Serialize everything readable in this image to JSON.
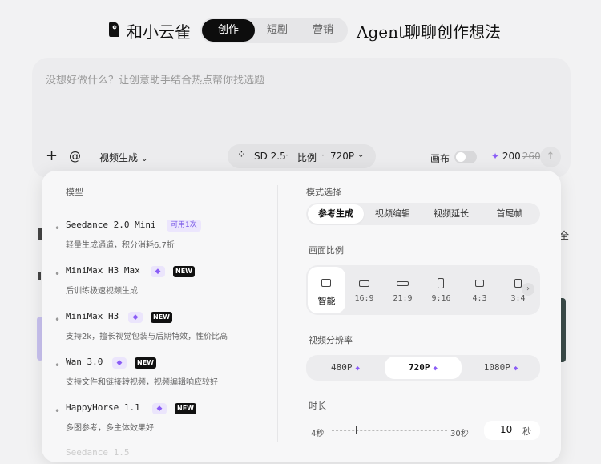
{
  "header": {
    "brand": "和小云雀",
    "tabs": [
      {
        "label": "创作",
        "active": true
      },
      {
        "label": "短剧",
        "active": false
      },
      {
        "label": "营销",
        "active": false
      }
    ],
    "agent_text": "Agent聊聊创作想法"
  },
  "input": {
    "placeholder": "没想好做什么？让创意助手结合热点帮你找选题"
  },
  "toolbar": {
    "plus": "+",
    "at": "@",
    "mode_label": "视频生成",
    "model_name": "SD 2.5",
    "ratio_label": "比例",
    "resolution": "720P",
    "canvas_label": "画布",
    "credits": "200",
    "credits_old": "260"
  },
  "panel": {
    "models_title": "模型",
    "models": [
      {
        "name": "Seedance 2.0 Mini",
        "badge": "可用1次",
        "desc": "轻量生成通道，积分消耗6.7折"
      },
      {
        "name": "MiniMax H3 Max",
        "gem": "◆",
        "new": "NEW",
        "desc": "后训练极速视频生成"
      },
      {
        "name": "MiniMax H3",
        "gem": "◆",
        "new": "NEW",
        "desc": "支持2k，擅长视觉包装与后期特效，性价比高"
      },
      {
        "name": "Wan 3.0",
        "gem": "◆",
        "new": "NEW",
        "desc": "支持文件和链接转视频，视频编辑响应较好"
      },
      {
        "name": "HappyHorse 1.1",
        "gem": "◆",
        "new": "NEW",
        "desc": "多图参考，多主体效果好"
      }
    ],
    "faded_model": "Seedance 1.5",
    "mode_title": "模式选择",
    "modes": [
      "参考生成",
      "视频编辑",
      "视频延长",
      "首尾帧"
    ],
    "active_mode": "参考生成",
    "ratio_title": "画面比例",
    "ratios": [
      "智能",
      "16:9",
      "21:9",
      "9:16",
      "4:3",
      "3:4"
    ],
    "active_ratio": "智能",
    "resolution_title": "视频分辨率",
    "resolutions": [
      "480P",
      "720P",
      "1080P"
    ],
    "active_resolution": "720P",
    "duration_title": "时长",
    "duration_min": "4秒",
    "duration_max": "30秒",
    "duration_value": "10",
    "duration_unit": "秒"
  },
  "background": {
    "right_text": "全"
  },
  "colors": {
    "accent": "#8a5cf6",
    "dark": "#0d0d0d"
  }
}
